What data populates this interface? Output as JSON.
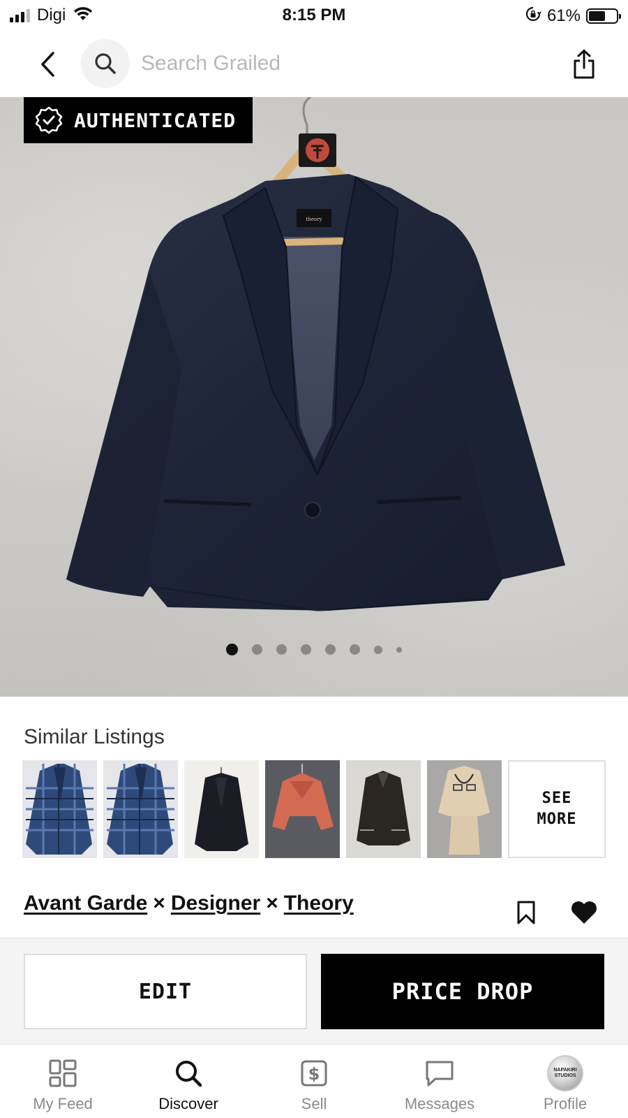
{
  "status_bar": {
    "carrier": "Digi",
    "time": "8:15 PM",
    "battery_percent": "61%",
    "battery_level": 0.61,
    "icons": [
      "signal-icon",
      "wifi-icon",
      "orientation-lock-icon",
      "battery-icon"
    ]
  },
  "top_nav": {
    "back_icon": "chevron-left-icon",
    "search_placeholder": "Search Grailed",
    "search_value": "",
    "share_icon": "share-icon"
  },
  "hero": {
    "badge_label": "AUTHENTICATED",
    "badge_icon": "verified-check-icon",
    "label_tag": "theory",
    "carousel_count": 8,
    "carousel_active_index": 0
  },
  "similar": {
    "title": "Similar Listings",
    "thumbnails": [
      {
        "id": "blue-plaid-coat-1"
      },
      {
        "id": "blue-plaid-coat-2"
      },
      {
        "id": "black-blazer"
      },
      {
        "id": "red-cropped-jacket"
      },
      {
        "id": "brown-leather-jacket"
      },
      {
        "id": "beige-suit-set"
      }
    ],
    "see_more_line1": "SEE",
    "see_more_line2": "MORE"
  },
  "listing": {
    "designers": [
      "Avant Garde",
      "Designer",
      "Theory"
    ],
    "separator": "×",
    "bookmark_icon": "bookmark-icon",
    "like_icon": "heart-icon"
  },
  "actions": {
    "edit_label": "EDIT",
    "price_drop_label": "PRICE DROP"
  },
  "tabbar": {
    "items": [
      {
        "label": "My Feed",
        "icon": "feed-grid-icon",
        "active": false
      },
      {
        "label": "Discover",
        "icon": "search-icon",
        "active": true
      },
      {
        "label": "Sell",
        "icon": "dollar-tag-icon",
        "active": false
      },
      {
        "label": "Messages",
        "icon": "chat-bubble-icon",
        "active": false
      },
      {
        "label": "Profile",
        "icon": "avatar",
        "active": false
      }
    ],
    "avatar_text_line1": "NAPAKIRI",
    "avatar_text_line2": "STUDIOS"
  },
  "colors": {
    "accent": "#000000",
    "background": "#ffffff",
    "jacket_navy": "#1f2638",
    "placeholder": "#b8b8b8"
  }
}
